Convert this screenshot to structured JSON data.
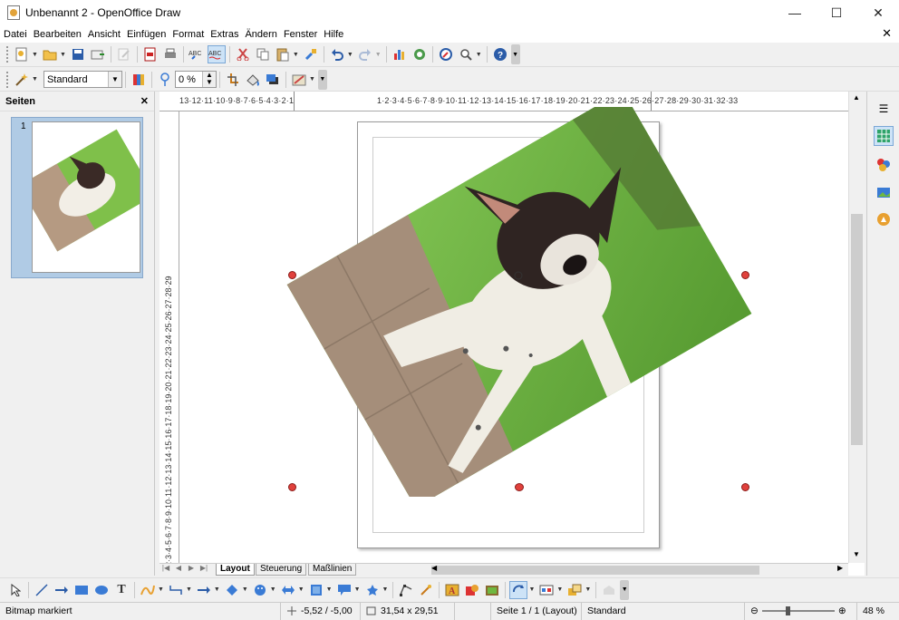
{
  "window": {
    "title": "Unbenannt 2 - OpenOffice Draw",
    "minimize": "—",
    "maximize": "☐",
    "close": "✕"
  },
  "menu": [
    "Datei",
    "Bearbeiten",
    "Ansicht",
    "Einfügen",
    "Format",
    "Extras",
    "Ändern",
    "Fenster",
    "Hilfe"
  ],
  "doc_close": "✕",
  "toolbar2": {
    "style_value": "Standard",
    "transparency_value": "0 %"
  },
  "pages_panel": {
    "title": "Seiten",
    "close": "✕",
    "page_number": "1"
  },
  "ruler": {
    "h_left": "13·12·11·10·9·8·7·6·5·4·3·2·1",
    "h_right": "1·2·3·4·5·6·7·8·9·10·11·12·13·14·15·16·17·18·19·20·21·22·23·24·25·26·27·28·29·30·31·32·33",
    "v": "1·2·3·4·5·6·7·8·9·10·11·12·13·14·15·16·17·18·19·20·21·22·23·24·25·26·27·28·29"
  },
  "tabs": [
    "Layout",
    "Steuerung",
    "Maßlinien"
  ],
  "status": {
    "selection": "Bitmap markiert",
    "position": "-5,52 / -5,00",
    "size": "31,54 x 29,51",
    "page": "Seite 1 / 1 (Layout)",
    "style": "Standard",
    "zoom": "48 %"
  },
  "colors": {
    "accent": "#1e73c8",
    "handle": "#e0413c",
    "grass": "#6fb840",
    "dog": "#f0ede4"
  }
}
